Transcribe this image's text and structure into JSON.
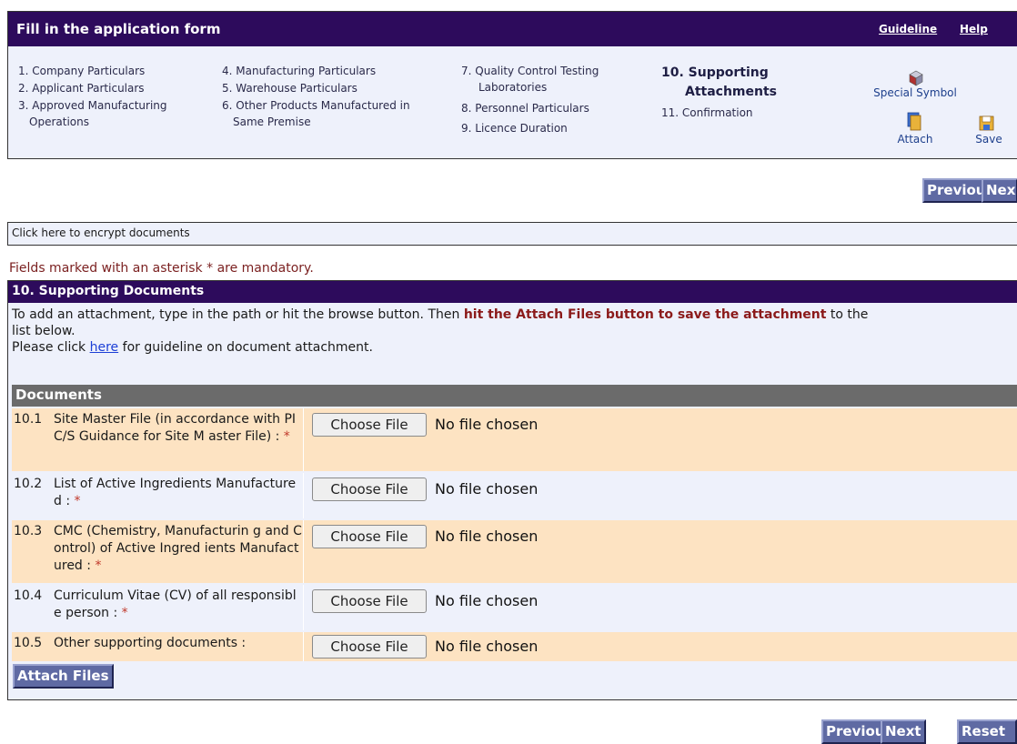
{
  "header": {
    "title": "Fill in the application form",
    "links": {
      "guideline": "Guideline",
      "help": "Help"
    },
    "steps": [
      [
        "1. Company Particulars",
        "2. Applicant Particulars",
        "3. Approved Manufacturing",
        "Operations"
      ],
      [
        "4. Manufacturing Particulars",
        "5. Warehouse Particulars",
        "6. Other Products Manufactured in",
        "Same Premise"
      ],
      [
        "7. Quality Control Testing",
        "Laboratories",
        "8. Personnel Particulars",
        "9. Licence Duration"
      ],
      [
        "10. Supporting",
        "Attachments",
        "11. Confirmation"
      ]
    ],
    "tools": {
      "special_symbol": "Special Symbol",
      "attach": "Attach",
      "save": "Save"
    }
  },
  "nav_top": {
    "previous": "Previous",
    "next": "Nex"
  },
  "encrypt": "Click here to encrypt documents",
  "mandatory_note": "Fields marked with an asterisk * are mandatory.",
  "section": {
    "title": "10. Supporting Documents",
    "intro_a": "To add an attachment, type in the path or hit the browse button. Then ",
    "intro_red": "hit the Attach Files button to save the attachment",
    "intro_b": " to the",
    "intro_c": "list below.",
    "guide_a": "Please click ",
    "guide_link": "here",
    "guide_b": " for guideline on document attachment.",
    "docs_header": "Documents",
    "file_button": "Choose File",
    "file_status": "No file chosen",
    "rows": [
      {
        "num": "10.1",
        "label": "Site Master File (in accordance with PIC/S Guidance for Site M aster File) :",
        "star": "*"
      },
      {
        "num": "10.2",
        "label": "List of Active Ingredients Manufactured :",
        "star": "*"
      },
      {
        "num": "10.3",
        "label": "CMC (Chemistry, Manufacturin g and Control) of Active Ingred ients Manufactured :",
        "star": "*"
      },
      {
        "num": "10.4",
        "label": "Curriculum Vitae (CV) of all responsible person :",
        "star": "*"
      },
      {
        "num": "10.5",
        "label": "Other supporting documents :",
        "star": ""
      }
    ],
    "attach_button": "Attach Files"
  },
  "nav_bottom": {
    "previous": "Previous",
    "next": "Next",
    "reset": "Reset"
  }
}
